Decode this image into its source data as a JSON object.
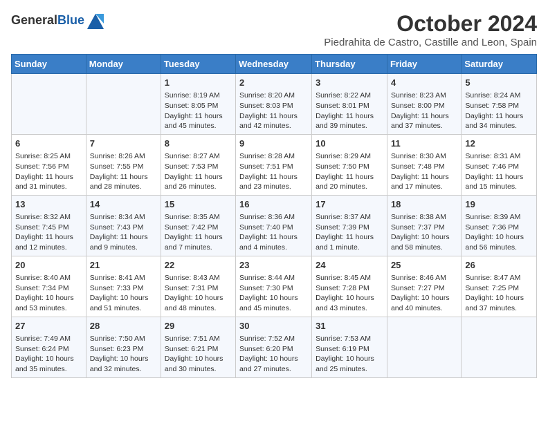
{
  "logo": {
    "text_general": "General",
    "text_blue": "Blue"
  },
  "header": {
    "month_year": "October 2024",
    "subtitle": "Piedrahita de Castro, Castille and Leon, Spain"
  },
  "weekdays": [
    "Sunday",
    "Monday",
    "Tuesday",
    "Wednesday",
    "Thursday",
    "Friday",
    "Saturday"
  ],
  "weeks": [
    [
      {
        "day": "",
        "content": ""
      },
      {
        "day": "",
        "content": ""
      },
      {
        "day": "1",
        "content": "Sunrise: 8:19 AM\nSunset: 8:05 PM\nDaylight: 11 hours and 45 minutes."
      },
      {
        "day": "2",
        "content": "Sunrise: 8:20 AM\nSunset: 8:03 PM\nDaylight: 11 hours and 42 minutes."
      },
      {
        "day": "3",
        "content": "Sunrise: 8:22 AM\nSunset: 8:01 PM\nDaylight: 11 hours and 39 minutes."
      },
      {
        "day": "4",
        "content": "Sunrise: 8:23 AM\nSunset: 8:00 PM\nDaylight: 11 hours and 37 minutes."
      },
      {
        "day": "5",
        "content": "Sunrise: 8:24 AM\nSunset: 7:58 PM\nDaylight: 11 hours and 34 minutes."
      }
    ],
    [
      {
        "day": "6",
        "content": "Sunrise: 8:25 AM\nSunset: 7:56 PM\nDaylight: 11 hours and 31 minutes."
      },
      {
        "day": "7",
        "content": "Sunrise: 8:26 AM\nSunset: 7:55 PM\nDaylight: 11 hours and 28 minutes."
      },
      {
        "day": "8",
        "content": "Sunrise: 8:27 AM\nSunset: 7:53 PM\nDaylight: 11 hours and 26 minutes."
      },
      {
        "day": "9",
        "content": "Sunrise: 8:28 AM\nSunset: 7:51 PM\nDaylight: 11 hours and 23 minutes."
      },
      {
        "day": "10",
        "content": "Sunrise: 8:29 AM\nSunset: 7:50 PM\nDaylight: 11 hours and 20 minutes."
      },
      {
        "day": "11",
        "content": "Sunrise: 8:30 AM\nSunset: 7:48 PM\nDaylight: 11 hours and 17 minutes."
      },
      {
        "day": "12",
        "content": "Sunrise: 8:31 AM\nSunset: 7:46 PM\nDaylight: 11 hours and 15 minutes."
      }
    ],
    [
      {
        "day": "13",
        "content": "Sunrise: 8:32 AM\nSunset: 7:45 PM\nDaylight: 11 hours and 12 minutes."
      },
      {
        "day": "14",
        "content": "Sunrise: 8:34 AM\nSunset: 7:43 PM\nDaylight: 11 hours and 9 minutes."
      },
      {
        "day": "15",
        "content": "Sunrise: 8:35 AM\nSunset: 7:42 PM\nDaylight: 11 hours and 7 minutes."
      },
      {
        "day": "16",
        "content": "Sunrise: 8:36 AM\nSunset: 7:40 PM\nDaylight: 11 hours and 4 minutes."
      },
      {
        "day": "17",
        "content": "Sunrise: 8:37 AM\nSunset: 7:39 PM\nDaylight: 11 hours and 1 minute."
      },
      {
        "day": "18",
        "content": "Sunrise: 8:38 AM\nSunset: 7:37 PM\nDaylight: 10 hours and 58 minutes."
      },
      {
        "day": "19",
        "content": "Sunrise: 8:39 AM\nSunset: 7:36 PM\nDaylight: 10 hours and 56 minutes."
      }
    ],
    [
      {
        "day": "20",
        "content": "Sunrise: 8:40 AM\nSunset: 7:34 PM\nDaylight: 10 hours and 53 minutes."
      },
      {
        "day": "21",
        "content": "Sunrise: 8:41 AM\nSunset: 7:33 PM\nDaylight: 10 hours and 51 minutes."
      },
      {
        "day": "22",
        "content": "Sunrise: 8:43 AM\nSunset: 7:31 PM\nDaylight: 10 hours and 48 minutes."
      },
      {
        "day": "23",
        "content": "Sunrise: 8:44 AM\nSunset: 7:30 PM\nDaylight: 10 hours and 45 minutes."
      },
      {
        "day": "24",
        "content": "Sunrise: 8:45 AM\nSunset: 7:28 PM\nDaylight: 10 hours and 43 minutes."
      },
      {
        "day": "25",
        "content": "Sunrise: 8:46 AM\nSunset: 7:27 PM\nDaylight: 10 hours and 40 minutes."
      },
      {
        "day": "26",
        "content": "Sunrise: 8:47 AM\nSunset: 7:25 PM\nDaylight: 10 hours and 37 minutes."
      }
    ],
    [
      {
        "day": "27",
        "content": "Sunrise: 7:49 AM\nSunset: 6:24 PM\nDaylight: 10 hours and 35 minutes."
      },
      {
        "day": "28",
        "content": "Sunrise: 7:50 AM\nSunset: 6:23 PM\nDaylight: 10 hours and 32 minutes."
      },
      {
        "day": "29",
        "content": "Sunrise: 7:51 AM\nSunset: 6:21 PM\nDaylight: 10 hours and 30 minutes."
      },
      {
        "day": "30",
        "content": "Sunrise: 7:52 AM\nSunset: 6:20 PM\nDaylight: 10 hours and 27 minutes."
      },
      {
        "day": "31",
        "content": "Sunrise: 7:53 AM\nSunset: 6:19 PM\nDaylight: 10 hours and 25 minutes."
      },
      {
        "day": "",
        "content": ""
      },
      {
        "day": "",
        "content": ""
      }
    ]
  ]
}
